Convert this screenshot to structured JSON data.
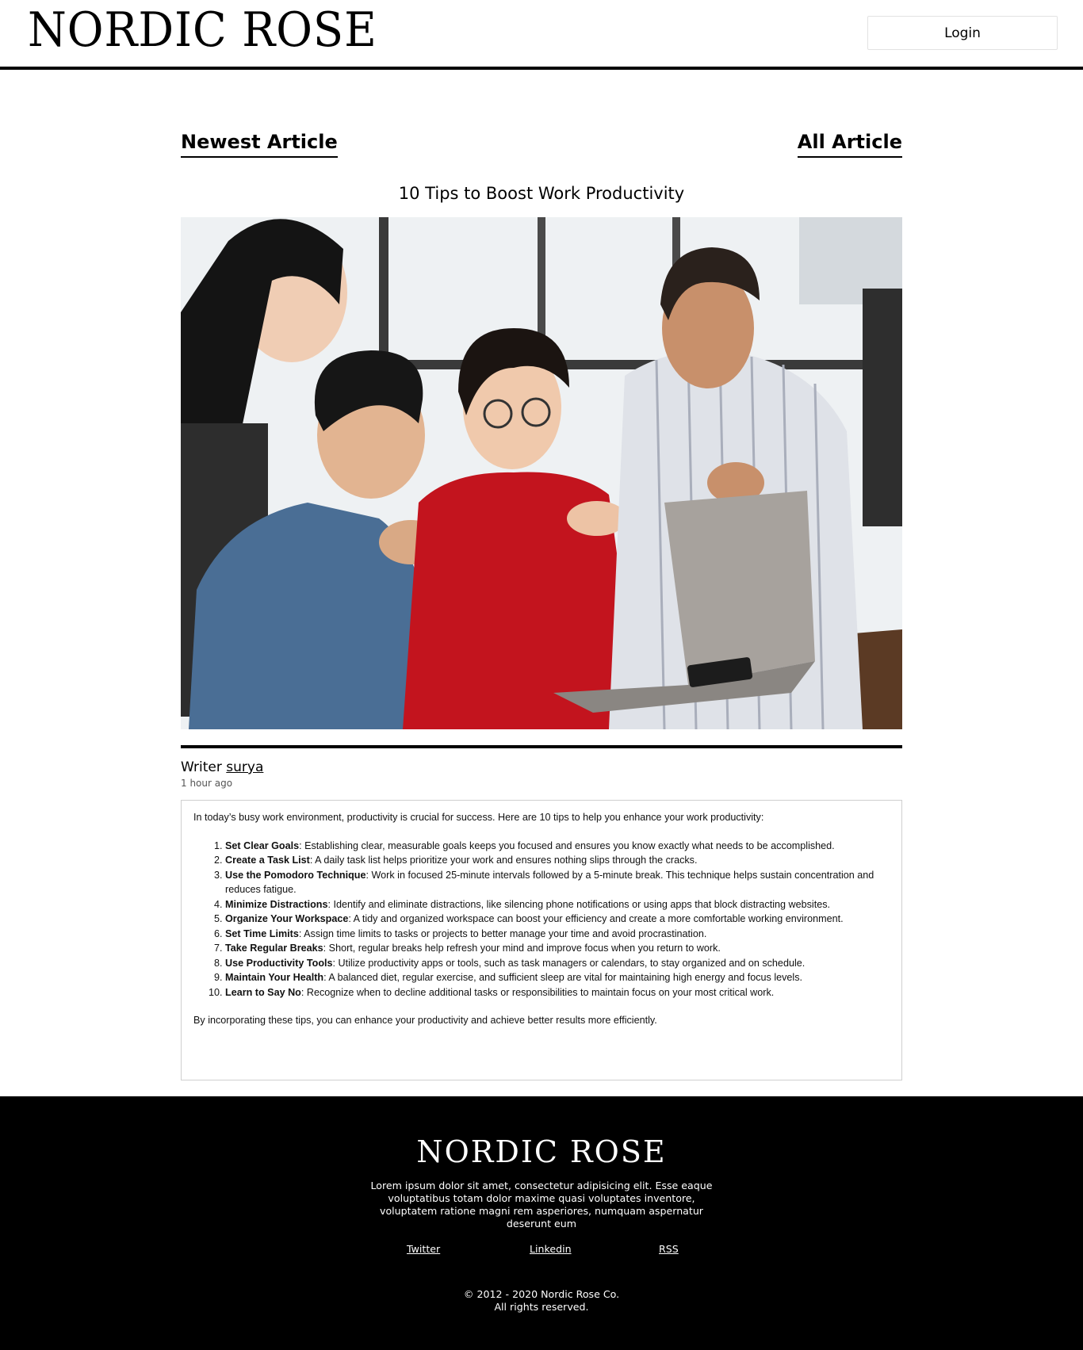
{
  "header": {
    "logo": "NORDIC ROSE",
    "login_label": "Login"
  },
  "sections": {
    "newest": "Newest Article",
    "all": "All Article"
  },
  "article": {
    "title": "10 Tips to Boost Work Productivity",
    "image_alt": "people gathered around a laptop",
    "writer_label": "Writer",
    "writer_name": "surya",
    "time_ago": "1 hour ago",
    "intro": "In today’s busy work environment, productivity is crucial for success. Here are 10 tips to help you enhance your work productivity:",
    "tips": [
      {
        "title": "Set Clear Goals",
        "text": ": Establishing clear, measurable goals keeps you focused and ensures you know exactly what needs to be accomplished."
      },
      {
        "title": "Create a Task List",
        "text": ": A daily task list helps prioritize your work and ensures nothing slips through the cracks."
      },
      {
        "title": "Use the Pomodoro Technique",
        "text": ": Work in focused 25-minute intervals followed by a 5-minute break. This technique helps sustain concentration and reduces fatigue."
      },
      {
        "title": "Minimize Distractions",
        "text": ": Identify and eliminate distractions, like silencing phone notifications or using apps that block distracting websites."
      },
      {
        "title": "Organize Your Workspace",
        "text": ": A tidy and organized workspace can boost your efficiency and create a more comfortable working environment."
      },
      {
        "title": "Set Time Limits",
        "text": ": Assign time limits to tasks or projects to better manage your time and avoid procrastination."
      },
      {
        "title": "Take Regular Breaks",
        "text": ": Short, regular breaks help refresh your mind and improve focus when you return to work."
      },
      {
        "title": "Use Productivity Tools",
        "text": ": Utilize productivity apps or tools, such as task managers or calendars, to stay organized and on schedule."
      },
      {
        "title": "Maintain Your Health",
        "text": ": A balanced diet, regular exercise, and sufficient sleep are vital for maintaining high energy and focus levels."
      },
      {
        "title": "Learn to Say No",
        "text": ": Recognize when to decline additional tasks or responsibilities to maintain focus on your most critical work."
      }
    ],
    "outro": "By incorporating these tips, you can enhance your productivity and achieve better results more efficiently."
  },
  "footer": {
    "logo": "NORDIC ROSE",
    "text": "Lorem ipsum dolor sit amet, consectetur adipisicing elit. Esse eaque voluptatibus totam dolor maxime quasi voluptates inventore, voluptatem ratione magni rem asperiores, numquam aspernatur deserunt eum",
    "links": [
      "Twitter",
      "Linkedin",
      "RSS"
    ],
    "copyright_line1": "© 2012 - 2020 Nordic Rose Co.",
    "copyright_line2": "All rights reserved."
  },
  "colors": {
    "accent": "#000000",
    "background": "#ffffff",
    "footer_bg": "#000000",
    "shirt_red": "#c3141e",
    "denim": "#4a6e95"
  }
}
